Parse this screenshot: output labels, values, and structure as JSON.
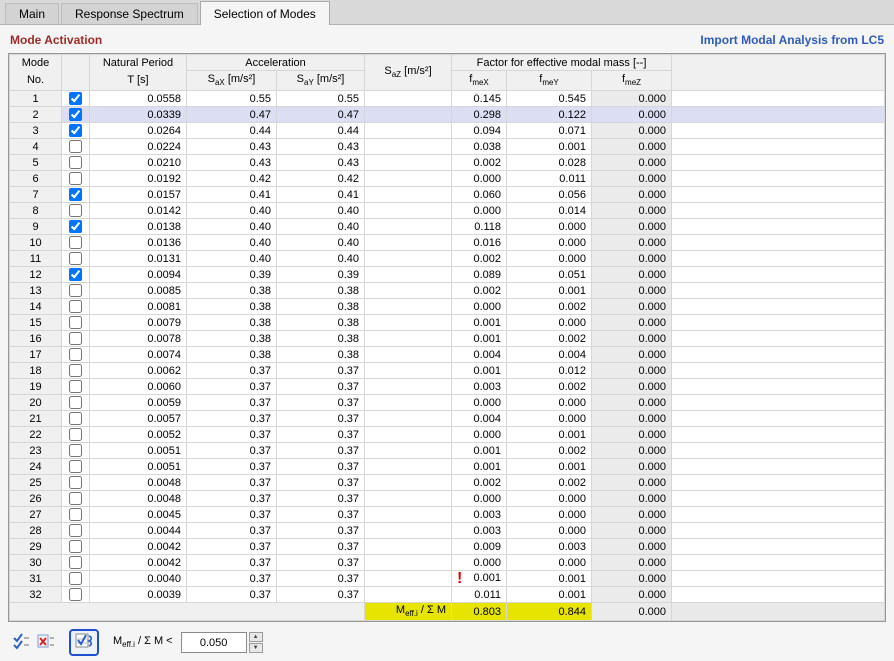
{
  "tabs": [
    {
      "label": "Main",
      "active": false
    },
    {
      "label": "Response Spectrum",
      "active": false
    },
    {
      "label": "Selection of Modes",
      "active": true
    }
  ],
  "section": {
    "title": "Mode Activation",
    "import_link": "Import Modal Analysis from LC5"
  },
  "table": {
    "header": {
      "mode_line1": "Mode",
      "mode_line2": "No.",
      "period_line1": "Natural Period",
      "period_line2": "T [s]",
      "accel_group": "Acceleration",
      "sax": {
        "pre": "S",
        "sub": "aX",
        "post": " [m/s²]"
      },
      "say": {
        "pre": "S",
        "sub": "aY",
        "post": " [m/s²]"
      },
      "saz": {
        "pre": "S",
        "sub": "aZ",
        "post": " [m/s²]"
      },
      "factor_group": "Factor for effective modal mass [--]",
      "fmex": {
        "pre": "f",
        "sub": "meX",
        "post": ""
      },
      "fmey": {
        "pre": "f",
        "sub": "meY",
        "post": ""
      },
      "fmez": {
        "pre": "f",
        "sub": "meZ",
        "post": ""
      }
    },
    "selected_row_no": 2,
    "warning_row_no": 31,
    "rows": [
      {
        "no": 1,
        "checked": true,
        "period": "0.0558",
        "sax": "0.55",
        "say": "0.55",
        "saz": "",
        "fmex": "0.145",
        "fmey": "0.545",
        "fmez": "0.000"
      },
      {
        "no": 2,
        "checked": true,
        "period": "0.0339",
        "sax": "0.47",
        "say": "0.47",
        "saz": "",
        "fmex": "0.298",
        "fmey": "0.122",
        "fmez": "0.000"
      },
      {
        "no": 3,
        "checked": true,
        "period": "0.0264",
        "sax": "0.44",
        "say": "0.44",
        "saz": "",
        "fmex": "0.094",
        "fmey": "0.071",
        "fmez": "0.000"
      },
      {
        "no": 4,
        "checked": false,
        "period": "0.0224",
        "sax": "0.43",
        "say": "0.43",
        "saz": "",
        "fmex": "0.038",
        "fmey": "0.001",
        "fmez": "0.000"
      },
      {
        "no": 5,
        "checked": false,
        "period": "0.0210",
        "sax": "0.43",
        "say": "0.43",
        "saz": "",
        "fmex": "0.002",
        "fmey": "0.028",
        "fmez": "0.000"
      },
      {
        "no": 6,
        "checked": false,
        "period": "0.0192",
        "sax": "0.42",
        "say": "0.42",
        "saz": "",
        "fmex": "0.000",
        "fmey": "0.011",
        "fmez": "0.000"
      },
      {
        "no": 7,
        "checked": true,
        "period": "0.0157",
        "sax": "0.41",
        "say": "0.41",
        "saz": "",
        "fmex": "0.060",
        "fmey": "0.056",
        "fmez": "0.000"
      },
      {
        "no": 8,
        "checked": false,
        "period": "0.0142",
        "sax": "0.40",
        "say": "0.40",
        "saz": "",
        "fmex": "0.000",
        "fmey": "0.014",
        "fmez": "0.000"
      },
      {
        "no": 9,
        "checked": true,
        "period": "0.0138",
        "sax": "0.40",
        "say": "0.40",
        "saz": "",
        "fmex": "0.118",
        "fmey": "0.000",
        "fmez": "0.000"
      },
      {
        "no": 10,
        "checked": false,
        "period": "0.0136",
        "sax": "0.40",
        "say": "0.40",
        "saz": "",
        "fmex": "0.016",
        "fmey": "0.000",
        "fmez": "0.000"
      },
      {
        "no": 11,
        "checked": false,
        "period": "0.0131",
        "sax": "0.40",
        "say": "0.40",
        "saz": "",
        "fmex": "0.002",
        "fmey": "0.000",
        "fmez": "0.000"
      },
      {
        "no": 12,
        "checked": true,
        "period": "0.0094",
        "sax": "0.39",
        "say": "0.39",
        "saz": "",
        "fmex": "0.089",
        "fmey": "0.051",
        "fmez": "0.000"
      },
      {
        "no": 13,
        "checked": false,
        "period": "0.0085",
        "sax": "0.38",
        "say": "0.38",
        "saz": "",
        "fmex": "0.002",
        "fmey": "0.001",
        "fmez": "0.000"
      },
      {
        "no": 14,
        "checked": false,
        "period": "0.0081",
        "sax": "0.38",
        "say": "0.38",
        "saz": "",
        "fmex": "0.000",
        "fmey": "0.002",
        "fmez": "0.000"
      },
      {
        "no": 15,
        "checked": false,
        "period": "0.0079",
        "sax": "0.38",
        "say": "0.38",
        "saz": "",
        "fmex": "0.001",
        "fmey": "0.000",
        "fmez": "0.000"
      },
      {
        "no": 16,
        "checked": false,
        "period": "0.0078",
        "sax": "0.38",
        "say": "0.38",
        "saz": "",
        "fmex": "0.001",
        "fmey": "0.002",
        "fmez": "0.000"
      },
      {
        "no": 17,
        "checked": false,
        "period": "0.0074",
        "sax": "0.38",
        "say": "0.38",
        "saz": "",
        "fmex": "0.004",
        "fmey": "0.004",
        "fmez": "0.000"
      },
      {
        "no": 18,
        "checked": false,
        "period": "0.0062",
        "sax": "0.37",
        "say": "0.37",
        "saz": "",
        "fmex": "0.001",
        "fmey": "0.012",
        "fmez": "0.000"
      },
      {
        "no": 19,
        "checked": false,
        "period": "0.0060",
        "sax": "0.37",
        "say": "0.37",
        "saz": "",
        "fmex": "0.003",
        "fmey": "0.002",
        "fmez": "0.000"
      },
      {
        "no": 20,
        "checked": false,
        "period": "0.0059",
        "sax": "0.37",
        "say": "0.37",
        "saz": "",
        "fmex": "0.000",
        "fmey": "0.000",
        "fmez": "0.000"
      },
      {
        "no": 21,
        "checked": false,
        "period": "0.0057",
        "sax": "0.37",
        "say": "0.37",
        "saz": "",
        "fmex": "0.004",
        "fmey": "0.000",
        "fmez": "0.000"
      },
      {
        "no": 22,
        "checked": false,
        "period": "0.0052",
        "sax": "0.37",
        "say": "0.37",
        "saz": "",
        "fmex": "0.000",
        "fmey": "0.001",
        "fmez": "0.000"
      },
      {
        "no": 23,
        "checked": false,
        "period": "0.0051",
        "sax": "0.37",
        "say": "0.37",
        "saz": "",
        "fmex": "0.001",
        "fmey": "0.002",
        "fmez": "0.000"
      },
      {
        "no": 24,
        "checked": false,
        "period": "0.0051",
        "sax": "0.37",
        "say": "0.37",
        "saz": "",
        "fmex": "0.001",
        "fmey": "0.001",
        "fmez": "0.000"
      },
      {
        "no": 25,
        "checked": false,
        "period": "0.0048",
        "sax": "0.37",
        "say": "0.37",
        "saz": "",
        "fmex": "0.002",
        "fmey": "0.002",
        "fmez": "0.000"
      },
      {
        "no": 26,
        "checked": false,
        "period": "0.0048",
        "sax": "0.37",
        "say": "0.37",
        "saz": "",
        "fmex": "0.000",
        "fmey": "0.000",
        "fmez": "0.000"
      },
      {
        "no": 27,
        "checked": false,
        "period": "0.0045",
        "sax": "0.37",
        "say": "0.37",
        "saz": "",
        "fmex": "0.003",
        "fmey": "0.000",
        "fmez": "0.000"
      },
      {
        "no": 28,
        "checked": false,
        "period": "0.0044",
        "sax": "0.37",
        "say": "0.37",
        "saz": "",
        "fmex": "0.003",
        "fmey": "0.000",
        "fmez": "0.000"
      },
      {
        "no": 29,
        "checked": false,
        "period": "0.0042",
        "sax": "0.37",
        "say": "0.37",
        "saz": "",
        "fmex": "0.009",
        "fmey": "0.003",
        "fmez": "0.000"
      },
      {
        "no": 30,
        "checked": false,
        "period": "0.0042",
        "sax": "0.37",
        "say": "0.37",
        "saz": "",
        "fmex": "0.000",
        "fmey": "0.000",
        "fmez": "0.000"
      },
      {
        "no": 31,
        "checked": false,
        "period": "0.0040",
        "sax": "0.37",
        "say": "0.37",
        "saz": "",
        "fmex": "0.001",
        "fmey": "0.001",
        "fmez": "0.000"
      },
      {
        "no": 32,
        "checked": false,
        "period": "0.0039",
        "sax": "0.37",
        "say": "0.37",
        "saz": "",
        "fmex": "0.011",
        "fmey": "0.001",
        "fmez": "0.000"
      }
    ],
    "footer": {
      "label": {
        "pre": "M",
        "sub": "eff.i",
        "post": " / Σ M"
      },
      "fmex": "0.803",
      "fmey": "0.844",
      "fmez": "0.000"
    }
  },
  "toolbar": {
    "icons": [
      "select-all-modes",
      "deselect-all-modes",
      "auto-select-modes"
    ],
    "threshold_label": {
      "pre": "M",
      "sub": "eff.i",
      "post": " / Σ M <"
    },
    "threshold_value": "0.050"
  },
  "colors": {
    "section_title": "#9c2b28",
    "import_link": "#2e5cb8",
    "highlight_yellow": "#e6e400",
    "selected_row": "#dcdff3",
    "warning_red": "#e00000",
    "auto_button_border": "#1e4fd0"
  }
}
